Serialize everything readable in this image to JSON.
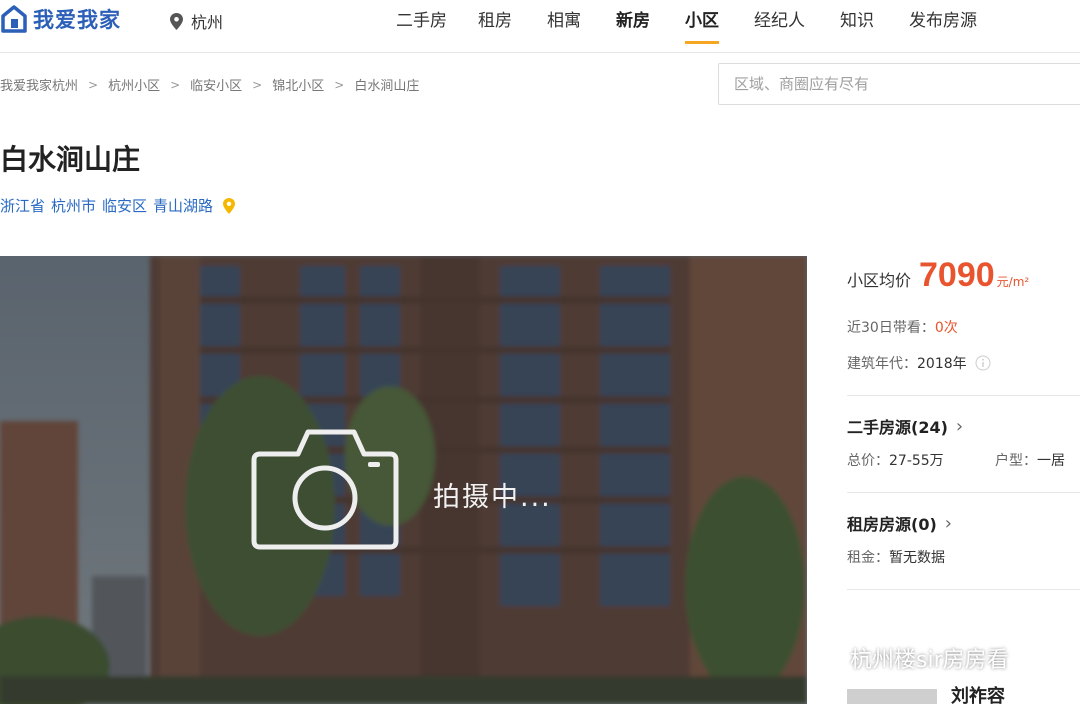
{
  "header": {
    "logo_text": "我爱我家",
    "city": "杭州",
    "nav": [
      "二手房",
      "租房",
      "相寓",
      "新房",
      "小区",
      "经纪人",
      "知识",
      "发布房源"
    ],
    "active_nav": "小区"
  },
  "breadcrumb": [
    "我爱我家杭州",
    "杭州小区",
    "临安小区",
    "锦北小区",
    "白水涧山庄"
  ],
  "search": {
    "placeholder": "区域、商圈应有尽有"
  },
  "community": {
    "name": "白水涧山庄",
    "address": [
      "浙江省",
      "杭州市",
      "临安区",
      "青山湖路"
    ]
  },
  "photo": {
    "status_text": "拍摄中..."
  },
  "panel": {
    "avg_label": "小区均价",
    "avg_price": "7090",
    "avg_unit": "元/m²",
    "visits_label": "近30日带看：",
    "visits_value": "0次",
    "year_label": "建筑年代：",
    "year_value": "2018年",
    "second_hand": {
      "title": "二手房源(24)",
      "price_label": "总价：",
      "price_value": "27-55万",
      "layout_label": "户型：",
      "layout_value": "一居"
    },
    "rental": {
      "title": "租房房源(0)",
      "rent_label": "租金：",
      "rent_value": "暂无数据"
    },
    "agent_name": "刘祚容"
  },
  "watermark": "杭州楼sir房房看",
  "colors": {
    "accent_orange": "#f5a623",
    "price_red": "#e8542e",
    "link_blue": "#2a6ac4",
    "brand_blue": "#2b5fb8"
  }
}
